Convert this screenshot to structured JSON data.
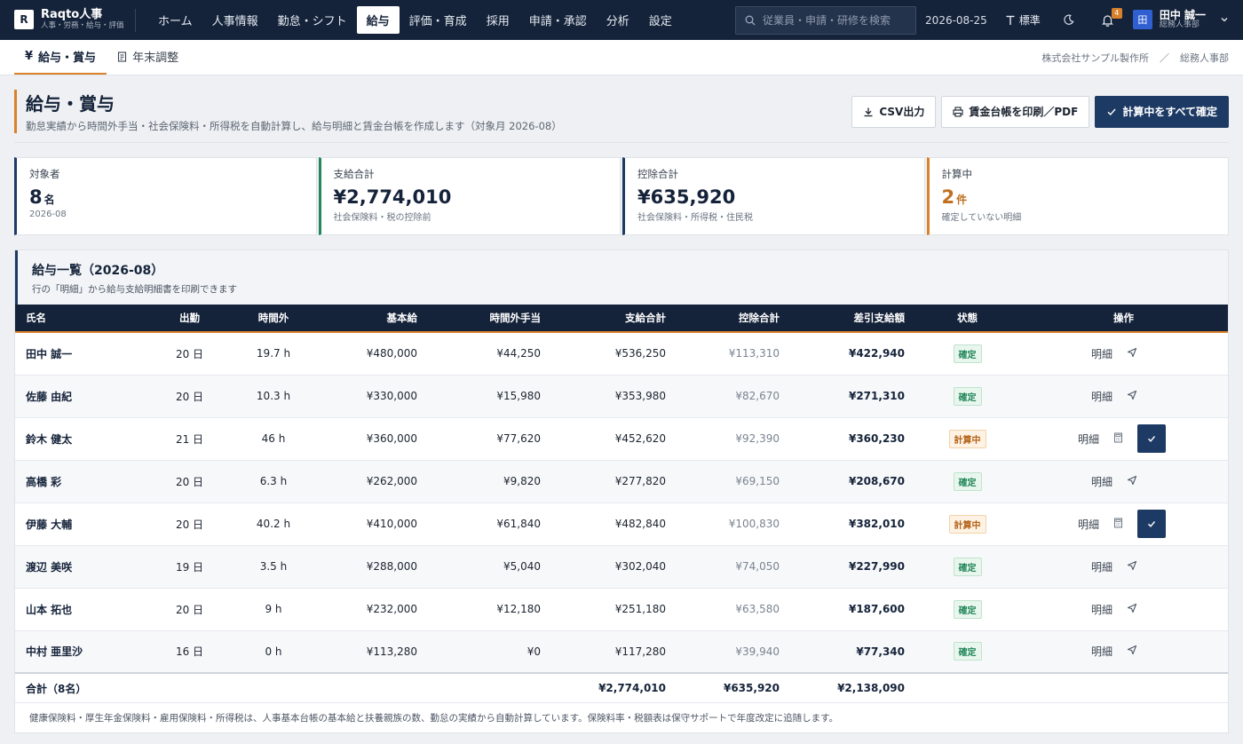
{
  "app": {
    "logo_letter": "R",
    "name": "Raqto人事",
    "tagline": "人事・労務・給与・評価"
  },
  "nav": [
    {
      "label": "ホーム",
      "active": false
    },
    {
      "label": "人事情報",
      "active": false
    },
    {
      "label": "勤怠・シフト",
      "active": false
    },
    {
      "label": "給与",
      "active": true
    },
    {
      "label": "評価・育成",
      "active": false
    },
    {
      "label": "採用",
      "active": false
    },
    {
      "label": "申請・承認",
      "active": false
    },
    {
      "label": "分析",
      "active": false
    },
    {
      "label": "設定",
      "active": false
    }
  ],
  "topbar": {
    "search_placeholder": "従業員・申請・研修を検索",
    "date": "2026-08-25",
    "text_size_label": "標準",
    "notification_count": "4",
    "user": {
      "avatar": "田",
      "name": "田中 誠一",
      "role": "総務人事部"
    }
  },
  "subtabs": [
    {
      "icon": "¥",
      "label": "給与・賞与",
      "active": true
    },
    {
      "icon": "doc",
      "label": "年末調整",
      "active": false
    }
  ],
  "breadcrumb": {
    "company": "株式会社サンプル製作所",
    "separator": "／",
    "department": "総務人事部"
  },
  "page": {
    "title": "給与・賞与",
    "subtitle": "勤怠実績から時間外手当・社会保険料・所得税を自動計算し、給与明細と賃金台帳を作成します（対象月 2026-08）",
    "actions": {
      "csv": "CSV出力",
      "print": "賃金台帳を印刷／PDF",
      "confirm_all": "計算中をすべて確定"
    }
  },
  "stats": [
    {
      "label": "対象者",
      "value": "8",
      "unit": "名",
      "sub": "2026-08",
      "color": "#1c3a64",
      "value_color": "#15233a"
    },
    {
      "label": "支給合計",
      "value": "¥2,774,010",
      "unit": "",
      "sub": "社会保険料・税の控除前",
      "color": "#23875a",
      "value_color": "#15233a"
    },
    {
      "label": "控除合計",
      "value": "¥635,920",
      "unit": "",
      "sub": "社会保険料・所得税・住民税",
      "color": "#1c3a64",
      "value_color": "#15233a"
    },
    {
      "label": "計算中",
      "value": "2",
      "unit": "件",
      "sub": "確定していない明細",
      "color": "#d9822b",
      "value_color": "#c0701f"
    }
  ],
  "table": {
    "title": "給与一覧（2026-08）",
    "subtitle": "行の「明細」から給与支給明細書を印刷できます",
    "headers": [
      "氏名",
      "出勤",
      "時間外",
      "基本給",
      "時間外手当",
      "支給合計",
      "控除合計",
      "差引支給額",
      "状態",
      "操作"
    ],
    "detail_label": "明細",
    "rows": [
      {
        "name": "田中 誠一",
        "days": "20 日",
        "overtime": "19.7 h",
        "base": "¥480,000",
        "ot_pay": "¥44,250",
        "gross": "¥536,250",
        "deduct": "¥113,310",
        "net": "¥422,940",
        "status": "確定",
        "state": "ok"
      },
      {
        "name": "佐藤 由紀",
        "days": "20 日",
        "overtime": "10.3 h",
        "base": "¥330,000",
        "ot_pay": "¥15,980",
        "gross": "¥353,980",
        "deduct": "¥82,670",
        "net": "¥271,310",
        "status": "確定",
        "state": "ok"
      },
      {
        "name": "鈴木 健太",
        "days": "21 日",
        "overtime": "46 h",
        "base": "¥360,000",
        "ot_pay": "¥77,620",
        "gross": "¥452,620",
        "deduct": "¥92,390",
        "net": "¥360,230",
        "status": "計算中",
        "state": "pending"
      },
      {
        "name": "高橋 彩",
        "days": "20 日",
        "overtime": "6.3 h",
        "base": "¥262,000",
        "ot_pay": "¥9,820",
        "gross": "¥277,820",
        "deduct": "¥69,150",
        "net": "¥208,670",
        "status": "確定",
        "state": "ok"
      },
      {
        "name": "伊藤 大輔",
        "days": "20 日",
        "overtime": "40.2 h",
        "base": "¥410,000",
        "ot_pay": "¥61,840",
        "gross": "¥482,840",
        "deduct": "¥100,830",
        "net": "¥382,010",
        "status": "計算中",
        "state": "pending"
      },
      {
        "name": "渡辺 美咲",
        "days": "19 日",
        "overtime": "3.5 h",
        "base": "¥288,000",
        "ot_pay": "¥5,040",
        "gross": "¥302,040",
        "deduct": "¥74,050",
        "net": "¥227,990",
        "status": "確定",
        "state": "ok"
      },
      {
        "name": "山本 拓也",
        "days": "20 日",
        "overtime": "9 h",
        "base": "¥232,000",
        "ot_pay": "¥12,180",
        "gross": "¥251,180",
        "deduct": "¥63,580",
        "net": "¥187,600",
        "status": "確定",
        "state": "ok"
      },
      {
        "name": "中村 亜里沙",
        "days": "16 日",
        "overtime": "0 h",
        "base": "¥113,280",
        "ot_pay": "¥0",
        "gross": "¥117,280",
        "deduct": "¥39,940",
        "net": "¥77,340",
        "status": "確定",
        "state": "ok"
      }
    ],
    "footer": {
      "label": "合計（8名）",
      "gross": "¥2,774,010",
      "deduct": "¥635,920",
      "net": "¥2,138,090"
    },
    "note": "健康保険料・厚生年金保険料・雇用保険料・所得税は、人事基本台帳の基本給と扶養親族の数、勤怠の実績から自動計算しています。保険料率・税額表は保守サポートで年度改定に追随します。"
  }
}
